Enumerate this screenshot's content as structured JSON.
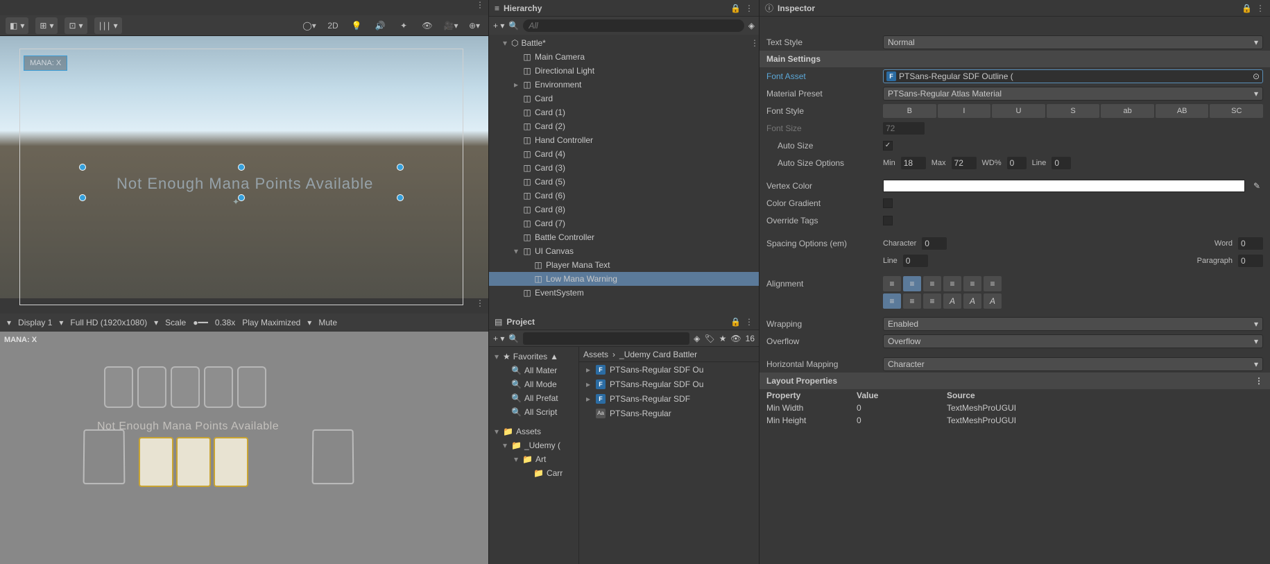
{
  "panels": {
    "hierarchy_title": "Hierarchy",
    "inspector_title": "Inspector",
    "project_title": "Project"
  },
  "scene": {
    "mana_label": "MANA: X",
    "warning_text": "Not Enough Mana Points Available",
    "btn_2d": "2D"
  },
  "game": {
    "display": "Display 1",
    "resolution": "Full HD (1920x1080)",
    "scale_label": "Scale",
    "scale_value": "0.38x",
    "play_mode": "Play Maximized",
    "mute": "Mute",
    "mana_label": "MANA: X",
    "warning_text": "Not Enough Mana Points Available"
  },
  "hierarchy": {
    "search_placeholder": "All",
    "root": "Battle*",
    "items": [
      "Main Camera",
      "Directional Light",
      "Environment",
      "Card",
      "Card (1)",
      "Card (2)",
      "Hand Controller",
      "Card (4)",
      "Card (3)",
      "Card (5)",
      "Card (6)",
      "Card (8)",
      "Card (7)",
      "Battle Controller"
    ],
    "ui_canvas": "UI Canvas",
    "ui_children": [
      "Player Mana Text",
      "Low Mana Warning"
    ],
    "event_system": "EventSystem"
  },
  "project": {
    "favorites_label": "Favorites",
    "favorites": [
      "All Mater",
      "All Mode",
      "All Prefat",
      "All Script"
    ],
    "assets_label": "Assets",
    "folder1": "_Udemy (",
    "folder2": "Art",
    "folder3": "Carr",
    "breadcrumb": [
      "Assets",
      "_Udemy Card Battler"
    ],
    "slider_val": "16",
    "files": [
      {
        "icon": "F",
        "name": "PTSans-Regular SDF Ou"
      },
      {
        "icon": "F",
        "name": "PTSans-Regular SDF Ou"
      },
      {
        "icon": "F",
        "name": "PTSans-Regular SDF"
      },
      {
        "icon": "Aa",
        "name": "PTSans-Regular"
      }
    ]
  },
  "inspector": {
    "text_style": {
      "label": "Text Style",
      "value": "Normal"
    },
    "main_settings": "Main Settings",
    "font_asset": {
      "label": "Font Asset",
      "value": "PTSans-Regular SDF Outline ("
    },
    "material_preset": {
      "label": "Material Preset",
      "value": "PTSans-Regular Atlas Material"
    },
    "font_style": {
      "label": "Font Style",
      "btns": [
        "B",
        "I",
        "U",
        "S",
        "ab",
        "AB",
        "SC"
      ]
    },
    "font_size": {
      "label": "Font Size",
      "value": "72"
    },
    "auto_size": {
      "label": "Auto Size",
      "checked": true
    },
    "auto_size_options": {
      "label": "Auto Size Options",
      "min_l": "Min",
      "min": "18",
      "max_l": "Max",
      "max": "72",
      "wd_l": "WD%",
      "wd": "0",
      "line_l": "Line",
      "line": "0"
    },
    "vertex_color": {
      "label": "Vertex Color"
    },
    "color_gradient": {
      "label": "Color Gradient"
    },
    "override_tags": {
      "label": "Override Tags"
    },
    "spacing": {
      "label": "Spacing Options (em)",
      "char_l": "Character",
      "char": "0",
      "word_l": "Word",
      "word": "0",
      "line_l": "Line",
      "line": "0",
      "para_l": "Paragraph",
      "para": "0"
    },
    "alignment": {
      "label": "Alignment"
    },
    "wrapping": {
      "label": "Wrapping",
      "value": "Enabled"
    },
    "overflow": {
      "label": "Overflow",
      "value": "Overflow"
    },
    "h_mapping": {
      "label": "Horizontal Mapping",
      "value": "Character"
    },
    "layout_props": "Layout Properties",
    "layout_cols": {
      "prop": "Property",
      "val": "Value",
      "src": "Source"
    },
    "layout_rows": [
      {
        "prop": "Min Width",
        "val": "0",
        "src": "TextMeshProUGUI"
      },
      {
        "prop": "Min Height",
        "val": "0",
        "src": "TextMeshProUGUI"
      }
    ]
  }
}
